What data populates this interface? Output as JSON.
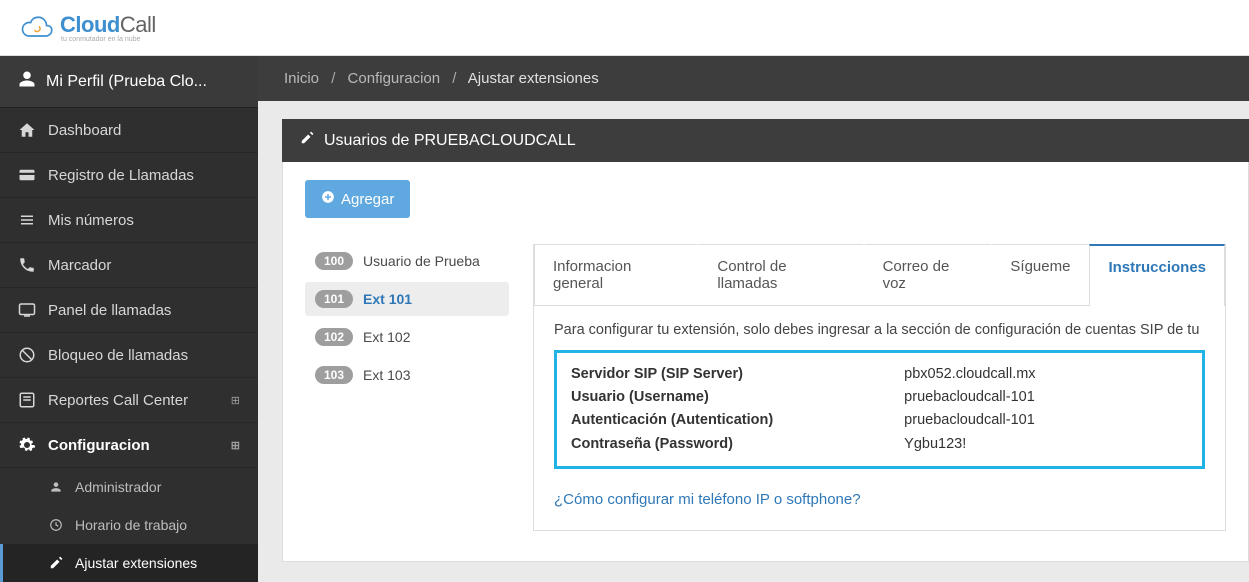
{
  "brand": {
    "main": "Cloud",
    "suffix": "Call",
    "tagline": "tu conmutador en la nube"
  },
  "profile": {
    "label": "Mi Perfil (Prueba Clo..."
  },
  "sidebar": [
    {
      "icon": "home",
      "label": "Dashboard",
      "expand": false
    },
    {
      "icon": "card",
      "label": "Registro de Llamadas",
      "expand": false
    },
    {
      "icon": "list",
      "label": "Mis números",
      "expand": false
    },
    {
      "icon": "phone",
      "label": "Marcador",
      "expand": false
    },
    {
      "icon": "panel",
      "label": "Panel de llamadas",
      "expand": false
    },
    {
      "icon": "block",
      "label": "Bloqueo de llamadas",
      "expand": false
    },
    {
      "icon": "report",
      "label": "Reportes Call Center",
      "expand": true
    },
    {
      "icon": "gear",
      "label": "Configuracion",
      "expand": true,
      "active": true
    }
  ],
  "sidebar_sub": [
    {
      "icon": "user",
      "label": "Administrador"
    },
    {
      "icon": "clock",
      "label": "Horario de trabajo"
    },
    {
      "icon": "adjust",
      "label": "Ajustar extensiones",
      "active": true
    }
  ],
  "breadcrumb": {
    "a": "Inicio",
    "b": "Configuracion",
    "c": "Ajustar extensiones"
  },
  "panel": {
    "title": "Usuarios de PRUEBACLOUDCALL",
    "add_label": "Agregar"
  },
  "extensions": [
    {
      "num": "100",
      "label": "Usuario de Prueba"
    },
    {
      "num": "101",
      "label": "Ext 101",
      "selected": true
    },
    {
      "num": "102",
      "label": "Ext 102"
    },
    {
      "num": "103",
      "label": "Ext 103"
    }
  ],
  "tabs": [
    {
      "label": "Informacion general"
    },
    {
      "label": "Control de llamadas"
    },
    {
      "label": "Correo de voz"
    },
    {
      "label": "Sígueme"
    },
    {
      "label": "Instrucciones",
      "active": true
    }
  ],
  "instructions": {
    "intro": "Para configurar tu extensión, solo debes ingresar a la sección de configuración de cuentas SIP de tu",
    "rows": [
      {
        "label": "Servidor SIP (SIP Server)",
        "value": "pbx052.cloudcall.mx"
      },
      {
        "label": "Usuario (Username)",
        "value": "pruebacloudcall-101"
      },
      {
        "label": "Autenticación (Autentication)",
        "value": "pruebacloudcall-101"
      },
      {
        "label": "Contraseña (Password)",
        "value": "Ygbu123!"
      }
    ],
    "help_link": "¿Cómo configurar mi teléfono IP o softphone?"
  }
}
